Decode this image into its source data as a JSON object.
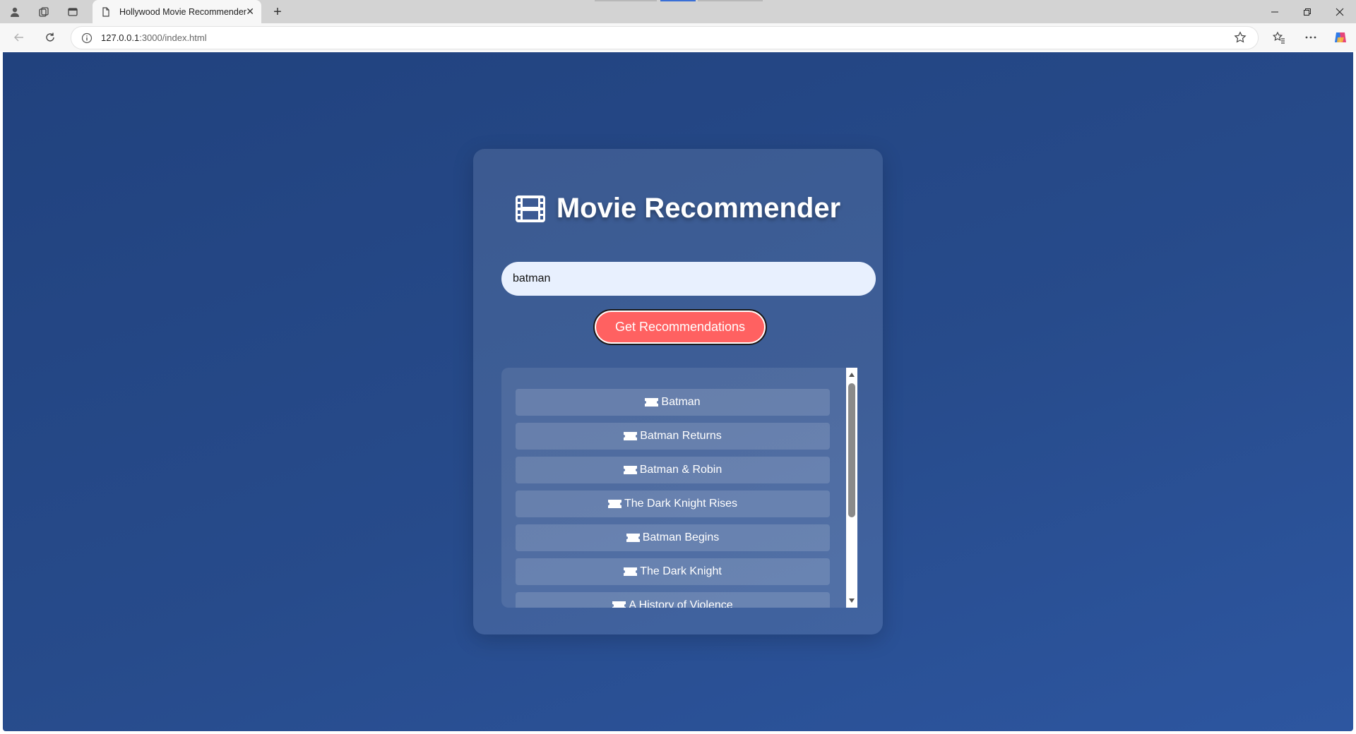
{
  "browser": {
    "tab_title": "Hollywood Movie Recommender",
    "url_host": "127.0.0.1",
    "url_path": ":3000/index.html"
  },
  "app": {
    "title": "Movie Recommender",
    "search_value": "batman",
    "button_label": "Get Recommendations",
    "results": [
      "Batman",
      "Batman Returns",
      "Batman & Robin",
      "The Dark Knight Rises",
      "Batman Begins",
      "The Dark Knight",
      "A History of Violence"
    ]
  },
  "colors": {
    "background": "#274b8b",
    "button": "#ff6161",
    "input": "#e8f0fe"
  }
}
